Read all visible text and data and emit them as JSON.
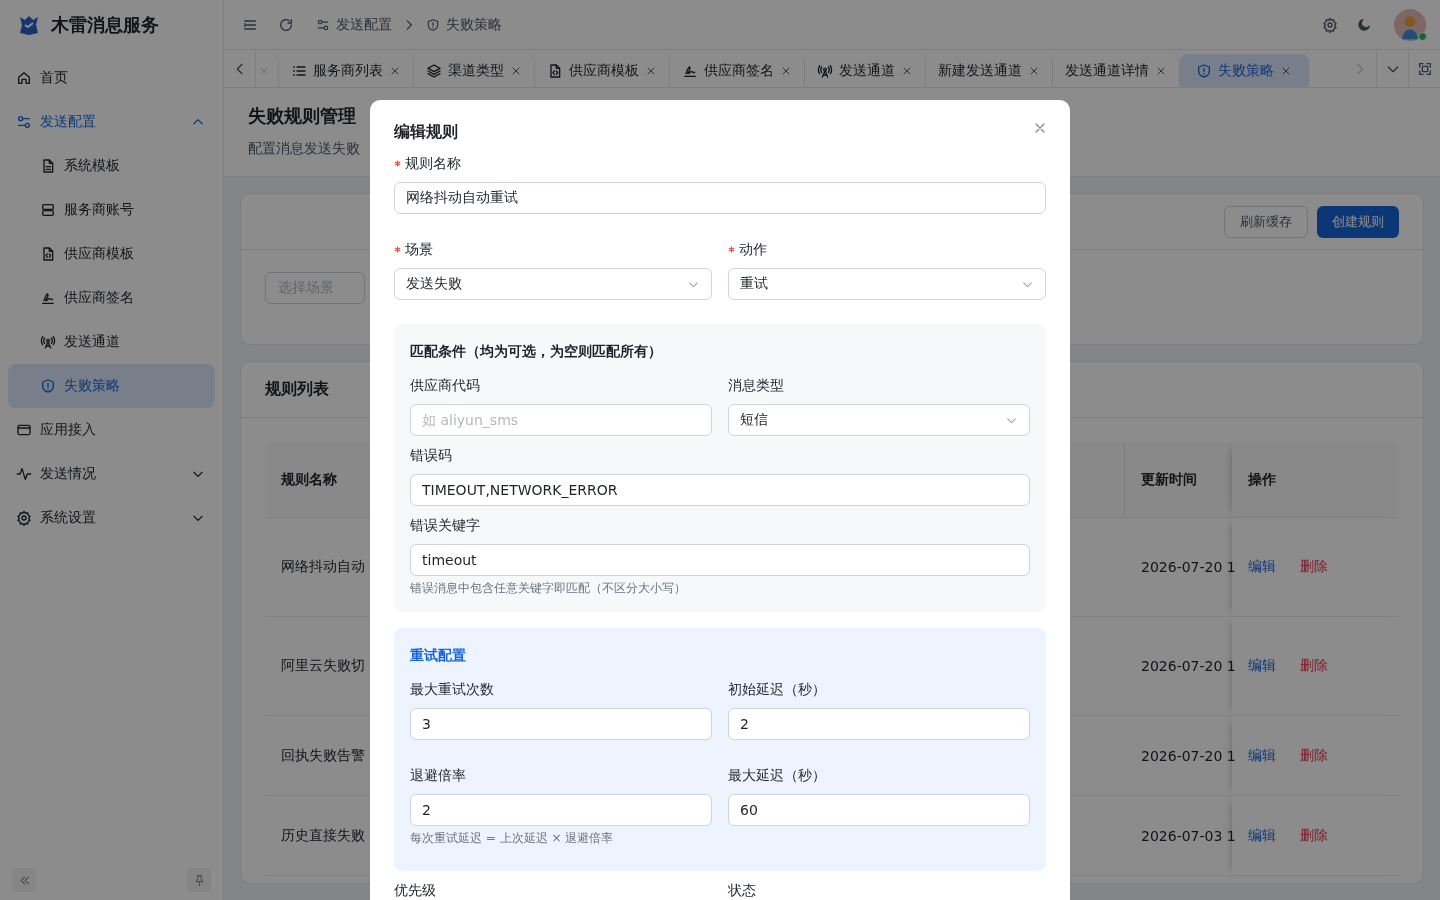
{
  "sidebar": {
    "app_name": "木雷消息服务",
    "items": [
      {
        "kind": "link",
        "label": "首页",
        "selected": false
      },
      {
        "kind": "group",
        "label": "发送配置",
        "selected": false,
        "active": true,
        "expanded": true,
        "children": [
          {
            "label": "系统模板",
            "selected": false
          },
          {
            "label": "服务商账号",
            "selected": false
          },
          {
            "label": "供应商模板",
            "selected": false
          },
          {
            "label": "供应商签名",
            "selected": false
          },
          {
            "label": "发送通道",
            "selected": false
          },
          {
            "label": "失败策略",
            "selected": true
          }
        ]
      },
      {
        "kind": "link",
        "label": "应用接入",
        "selected": false
      },
      {
        "kind": "group",
        "label": "发送情况",
        "selected": false,
        "active": false,
        "expanded": false
      },
      {
        "kind": "group",
        "label": "系统设置",
        "selected": false,
        "active": false,
        "expanded": false
      }
    ]
  },
  "header": {
    "breadcrumb": [
      {
        "label": "发送配置"
      },
      {
        "label": "失败策略"
      }
    ],
    "user": {
      "online": true
    }
  },
  "tabs": [
    {
      "kind": "clipped",
      "selected": false
    },
    {
      "kind": "tab",
      "label": "服务商列表",
      "selected": false
    },
    {
      "kind": "tab",
      "label": "渠道类型",
      "selected": false
    },
    {
      "kind": "tab",
      "label": "供应商模板",
      "selected": false
    },
    {
      "kind": "tab",
      "label": "供应商签名",
      "selected": false
    },
    {
      "kind": "tab",
      "label": "发送通道",
      "selected": false
    },
    {
      "kind": "tab",
      "label": "新建发送通道",
      "selected": false
    },
    {
      "kind": "tab",
      "label": "发送通道详情",
      "selected": false
    },
    {
      "kind": "tab",
      "label": "失败策略",
      "selected": true
    }
  ],
  "page": {
    "title": "失败规则管理",
    "subtitle": "配置消息发送失败",
    "filter": {
      "scene_placeholder": "选择场景"
    },
    "buttons": [
      {
        "label": "刷新缓存",
        "kind": "default"
      },
      {
        "label": "创建规则",
        "kind": "primary"
      }
    ],
    "rules": {
      "title": "规则列表",
      "columns": [
        "规则名称",
        "更新时间",
        "操作"
      ],
      "rows": [
        {
          "name": "网络抖动自动",
          "updated": "2026-07-20 1",
          "actions": [
            {
              "label": "编辑",
              "kind": "edit"
            },
            {
              "label": "删除",
              "kind": "danger"
            }
          ]
        },
        {
          "name": "阿里云失败切",
          "updated": "2026-07-20 1",
          "actions": [
            {
              "label": "编辑",
              "kind": "edit"
            },
            {
              "label": "删除",
              "kind": "danger"
            }
          ]
        },
        {
          "name": "回执失败告警",
          "updated": "2026-07-20 1",
          "actions": [
            {
              "label": "编辑",
              "kind": "edit"
            },
            {
              "label": "删除",
              "kind": "danger"
            }
          ]
        },
        {
          "name": "历史直接失败",
          "updated": "2026-07-03 1",
          "actions": [
            {
              "label": "编辑",
              "kind": "edit"
            },
            {
              "label": "删除",
              "kind": "danger"
            }
          ]
        }
      ]
    }
  },
  "modal": {
    "title": "编辑规则",
    "sections": [
      {
        "kind": "plain",
        "rows": [
          [
            {
              "label": "规则名称",
              "required": true,
              "kind": "input",
              "value": "网络抖动自动重试"
            }
          ],
          [
            {
              "label": "场景",
              "required": true,
              "kind": "select",
              "value": "发送失败"
            },
            {
              "label": "动作",
              "required": true,
              "kind": "select",
              "value": "重试"
            }
          ]
        ]
      },
      {
        "kind": "gray",
        "title": "匹配条件（均为可选，为空则匹配所有）",
        "rows": [
          [
            {
              "label": "供应商代码",
              "required": false,
              "kind": "input",
              "placeholder": "如 aliyun_sms"
            },
            {
              "label": "消息类型",
              "required": false,
              "kind": "select",
              "value": "短信"
            }
          ],
          [
            {
              "label": "错误码",
              "required": false,
              "kind": "input",
              "value": "TIMEOUT,NETWORK_ERROR"
            }
          ],
          [
            {
              "label": "错误关键字",
              "required": false,
              "kind": "input",
              "value": "timeout"
            }
          ]
        ],
        "hint": "错误消息中包含任意关键字即匹配（不区分大小写）"
      },
      {
        "kind": "blue",
        "title": "重试配置",
        "rows": [
          [
            {
              "label": "最大重试次数",
              "required": false,
              "kind": "input",
              "value": "3"
            },
            {
              "label": "初始延迟（秒）",
              "required": false,
              "kind": "input",
              "value": "2"
            }
          ],
          [
            {
              "label": "退避倍率",
              "required": false,
              "kind": "input",
              "value": "2"
            },
            {
              "label": "最大延迟（秒）",
              "required": false,
              "kind": "input",
              "value": "60"
            }
          ]
        ],
        "hint": "每次重试延迟 = 上次延迟 × 退避倍率"
      },
      {
        "kind": "plain",
        "rows": [
          [
            {
              "label": "优先级",
              "required": false,
              "kind": "label"
            },
            {
              "label": "状态",
              "required": false,
              "kind": "label"
            }
          ]
        ]
      }
    ]
  }
}
